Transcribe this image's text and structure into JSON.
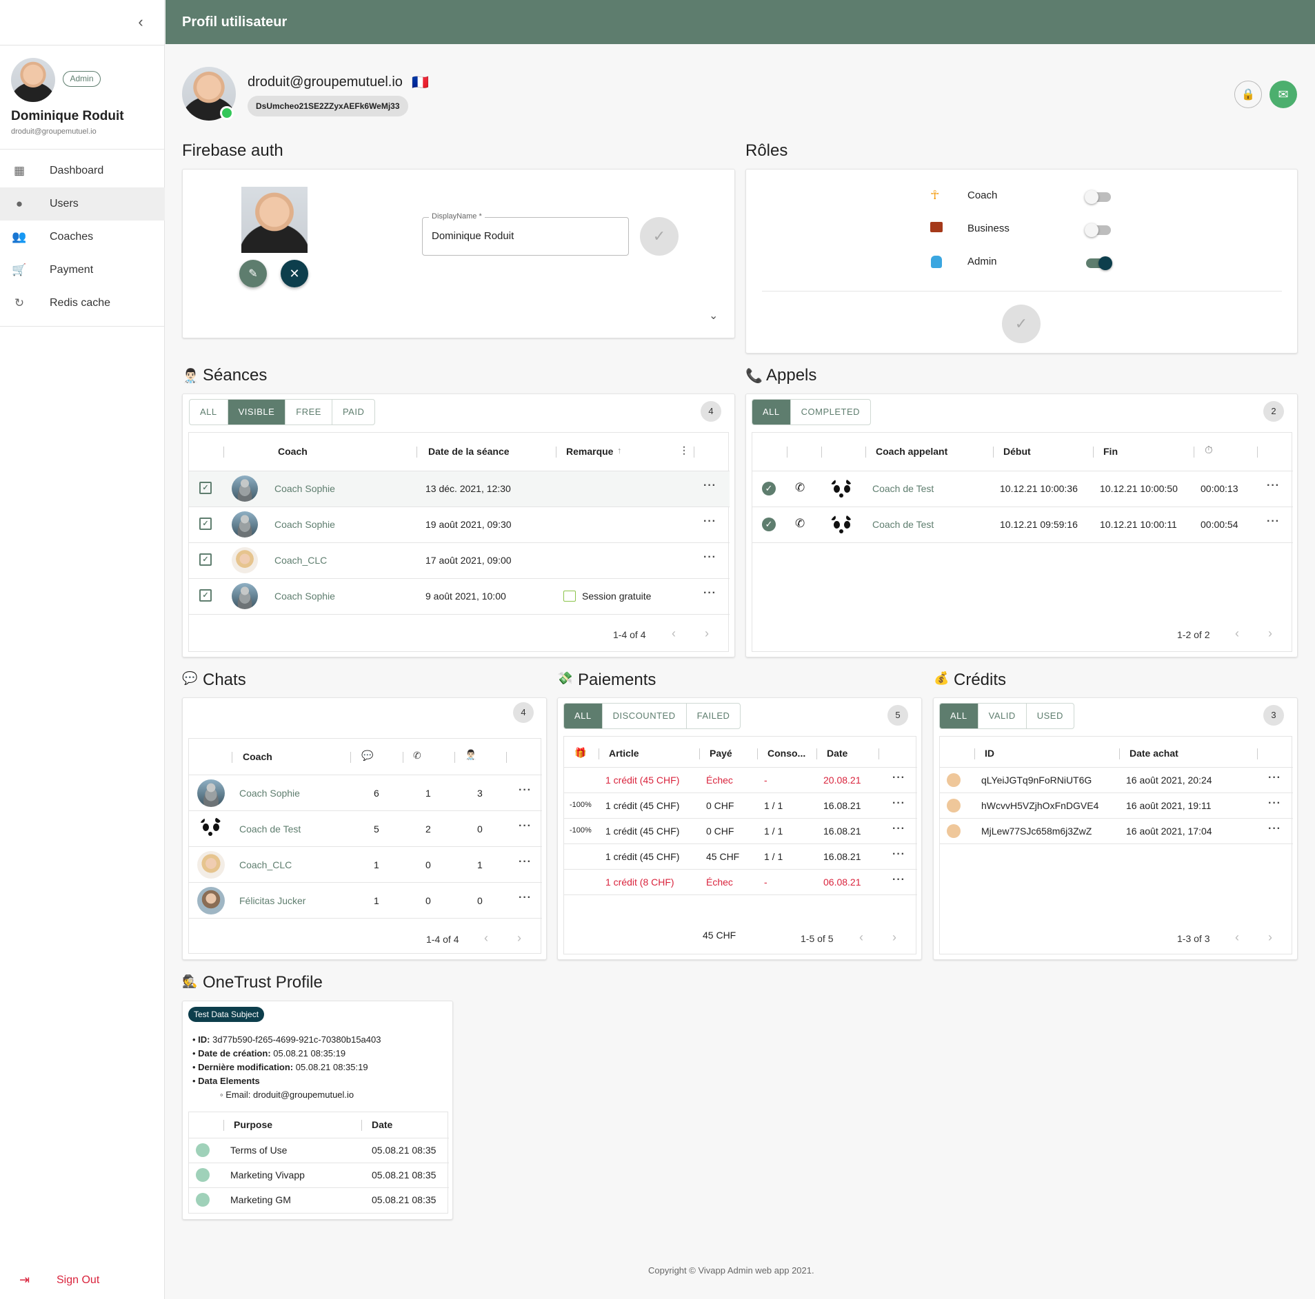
{
  "sidebar": {
    "user_name": "Dominique Roduit",
    "user_email": "droduit@groupemutuel.io",
    "role_badge": "Admin",
    "nav": [
      {
        "label": "Dashboard",
        "icon": "dashboard-icon"
      },
      {
        "label": "Users",
        "icon": "account-circle-icon"
      },
      {
        "label": "Coaches",
        "icon": "people-icon"
      },
      {
        "label": "Payment",
        "icon": "cart-icon"
      },
      {
        "label": "Redis cache",
        "icon": "history-icon"
      }
    ],
    "sign_out": "Sign Out"
  },
  "header": {
    "title": "Profil utilisateur"
  },
  "profile": {
    "email": "droduit@groupemutuel.io",
    "flag": "🇫🇷",
    "uid": "DsUmcheo21SE2ZZyxAEFk6WeMj33"
  },
  "firebase": {
    "title": "Firebase auth",
    "display_name_label": "DisplayName *",
    "display_name_value": "Dominique Roduit"
  },
  "roles": {
    "title": "Rôles",
    "items": [
      {
        "label": "Coach",
        "icon": "coach-icon",
        "enabled": false
      },
      {
        "label": "Business",
        "icon": "briefcase-icon",
        "enabled": false
      },
      {
        "label": "Admin",
        "icon": "android-icon",
        "enabled": true
      }
    ]
  },
  "seances": {
    "title": "Séances",
    "emoji": "👨🏻‍⚕️",
    "filters": [
      "ALL",
      "VISIBLE",
      "FREE",
      "PAID"
    ],
    "active_filter": "VISIBLE",
    "count": "4",
    "columns": [
      "Coach",
      "Date de la séance",
      "Remarque"
    ],
    "rows": [
      {
        "coach": "Coach Sophie",
        "avatar": "stone",
        "date": "13 déc. 2021, 12:30",
        "remark": ""
      },
      {
        "coach": "Coach Sophie",
        "avatar": "stone",
        "date": "19 août 2021, 09:30",
        "remark": ""
      },
      {
        "coach": "Coach_CLC",
        "avatar": "blonde",
        "date": "17 août 2021, 09:00",
        "remark": ""
      },
      {
        "coach": "Coach Sophie",
        "avatar": "stone",
        "date": "9 août 2021, 10:00",
        "remark": "Session gratuite"
      }
    ],
    "pagination": "1-4 of 4"
  },
  "appels": {
    "title": "Appels",
    "filters": [
      "ALL",
      "COMPLETED"
    ],
    "active_filter": "ALL",
    "count": "2",
    "columns": [
      "Coach appelant",
      "Début",
      "Fin"
    ],
    "rows": [
      {
        "coach": "Coach de Test",
        "start": "10.12.21 10:00:36",
        "end": "10.12.21 10:00:50",
        "duration": "00:00:13"
      },
      {
        "coach": "Coach de Test",
        "start": "10.12.21 09:59:16",
        "end": "10.12.21 10:00:11",
        "duration": "00:00:54"
      }
    ],
    "pagination": "1-2 of 2"
  },
  "chats": {
    "title": "Chats",
    "count": "4",
    "columns": [
      "Coach"
    ],
    "rows": [
      {
        "coach": "Coach Sophie",
        "avatar": "stone",
        "messages": "6",
        "calls": "1",
        "sessions": "3"
      },
      {
        "coach": "Coach de Test",
        "avatar": "panda",
        "messages": "5",
        "calls": "2",
        "sessions": "0"
      },
      {
        "coach": "Coach_CLC",
        "avatar": "blonde",
        "messages": "1",
        "calls": "0",
        "sessions": "1"
      },
      {
        "coach": "Félicitas Jucker",
        "avatar": "woman",
        "messages": "1",
        "calls": "0",
        "sessions": "0"
      }
    ],
    "pagination": "1-4 of 4"
  },
  "paiements": {
    "title": "Paiements",
    "filters": [
      "ALL",
      "DISCOUNTED",
      "FAILED"
    ],
    "active_filter": "ALL",
    "count": "5",
    "columns": [
      "Article",
      "Payé",
      "Conso...",
      "Date"
    ],
    "rows": [
      {
        "discount": "",
        "article": "1 crédit (45 CHF)",
        "paid": "Échec",
        "conso": "-",
        "date": "20.08.21",
        "failed": true
      },
      {
        "discount": "-100%",
        "article": "1 crédit (45 CHF)",
        "paid": "0 CHF",
        "conso": "1 / 1",
        "date": "16.08.21",
        "failed": false
      },
      {
        "discount": "-100%",
        "article": "1 crédit (45 CHF)",
        "paid": "0 CHF",
        "conso": "1 / 1",
        "date": "16.08.21",
        "failed": false
      },
      {
        "discount": "",
        "article": "1 crédit (45 CHF)",
        "paid": "45 CHF",
        "conso": "1 / 1",
        "date": "16.08.21",
        "failed": false
      },
      {
        "discount": "",
        "article": "1 crédit (8 CHF)",
        "paid": "Échec",
        "conso": "-",
        "date": "06.08.21",
        "failed": true
      }
    ],
    "total": "45 CHF",
    "pagination": "1-5 of 5"
  },
  "credits": {
    "title": "Crédits",
    "filters": [
      "ALL",
      "VALID",
      "USED"
    ],
    "active_filter": "ALL",
    "count": "3",
    "columns": [
      "ID",
      "Date achat"
    ],
    "rows": [
      {
        "id": "qLYeiJGTq9nFoRNiUT6G",
        "date": "16 août 2021, 20:24"
      },
      {
        "id": "hWcvvH5VZjhOxFnDGVE4",
        "date": "16 août 2021, 19:11"
      },
      {
        "id": "MjLew77SJc658m6j3ZwZ",
        "date": "16 août 2021, 17:04"
      }
    ],
    "pagination": "1-3 of 3"
  },
  "onetrust": {
    "title": "OneTrust Profile",
    "tag": "Test Data Subject",
    "id_label": "ID:",
    "id_value": "3d77b590-f265-4699-921c-70380b15a403",
    "created_label": "Date de création:",
    "created_value": "05.08.21 08:35:19",
    "modified_label": "Dernière modification:",
    "modified_value": "05.08.21 08:35:19",
    "elements_label": "Data Elements",
    "email_label": "Email:",
    "email_value": "droduit@groupemutuel.io",
    "columns": [
      "Purpose",
      "Date"
    ],
    "rows": [
      {
        "purpose": "Terms of Use",
        "date": "05.08.21 08:35"
      },
      {
        "purpose": "Marketing Vivapp",
        "date": "05.08.21 08:35"
      },
      {
        "purpose": "Marketing GM",
        "date": "05.08.21 08:35"
      }
    ]
  },
  "footer": "Copyright © Vivapp Admin web app 2021.",
  "colors": {
    "primary": "#5e7d6e",
    "dark": "#0d3e4c",
    "error": "#d9233c",
    "header": "#5e7d6e"
  }
}
